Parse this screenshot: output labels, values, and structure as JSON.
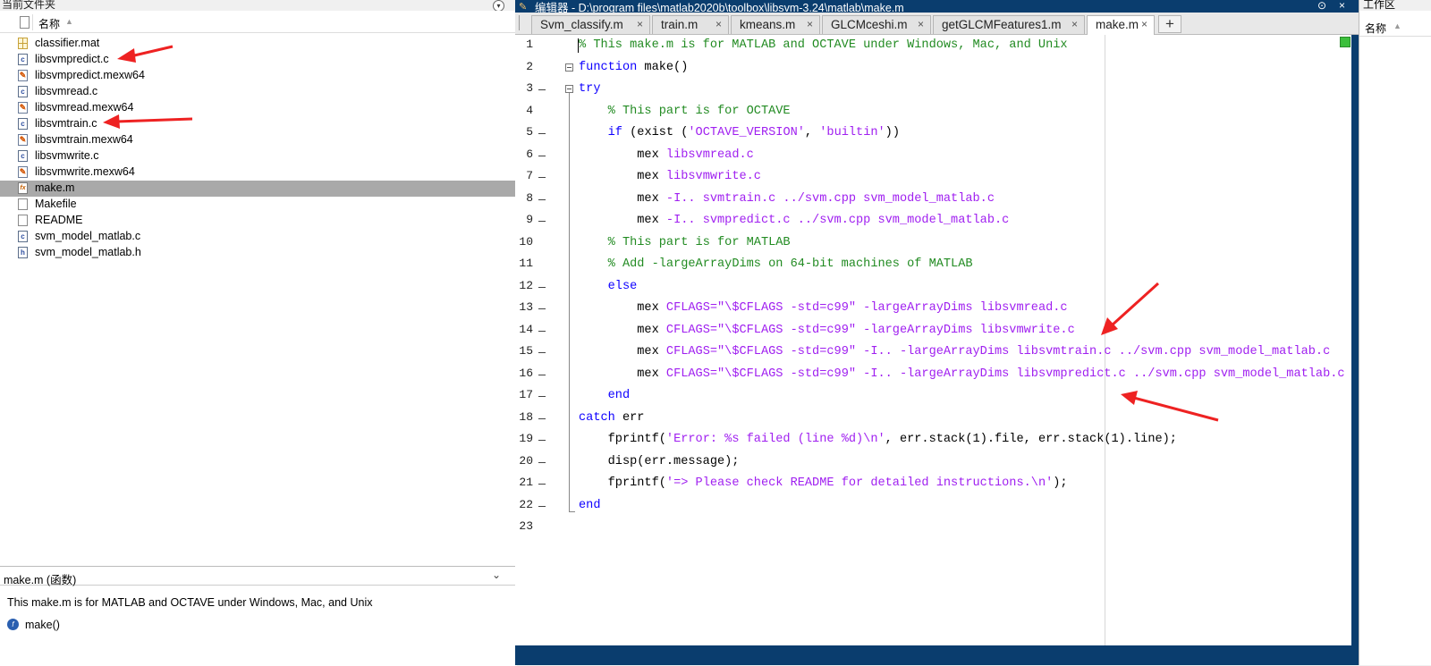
{
  "current_folder": {
    "title": "当前文件夹",
    "column_name": "名称",
    "files": [
      {
        "name": "classifier.mat",
        "type": "mat"
      },
      {
        "name": "libsvmpredict.c",
        "type": "c"
      },
      {
        "name": "libsvmpredict.mexw64",
        "type": "mex"
      },
      {
        "name": "libsvmread.c",
        "type": "c"
      },
      {
        "name": "libsvmread.mexw64",
        "type": "mex"
      },
      {
        "name": "libsvmtrain.c",
        "type": "c"
      },
      {
        "name": "libsvmtrain.mexw64",
        "type": "mex"
      },
      {
        "name": "libsvmwrite.c",
        "type": "c"
      },
      {
        "name": "libsvmwrite.mexw64",
        "type": "mex"
      },
      {
        "name": "make.m",
        "type": "m",
        "selected": true
      },
      {
        "name": "Makefile",
        "type": "plain"
      },
      {
        "name": "README",
        "type": "plain"
      },
      {
        "name": "svm_model_matlab.c",
        "type": "c"
      },
      {
        "name": "svm_model_matlab.h",
        "type": "h"
      }
    ]
  },
  "details": {
    "header": "make.m  (函数)",
    "description": "This make.m is for MATLAB and OCTAVE under Windows, Mac, and Unix",
    "function": "make()"
  },
  "editor": {
    "title": "编辑器 - D:\\program files\\matlab2020b\\toolbox\\libsvm-3.24\\matlab\\make.m",
    "tabs": [
      {
        "label": "Svm_classify.m",
        "active": false
      },
      {
        "label": "train.m",
        "active": false
      },
      {
        "label": "kmeans.m",
        "active": false
      },
      {
        "label": "GLCMceshi.m",
        "active": false
      },
      {
        "label": "getGLCMFeatures1.m",
        "active": false
      },
      {
        "label": "make.m",
        "active": true
      }
    ],
    "add_tab_label": "+",
    "close_glyph": "×",
    "lines": [
      {
        "n": "1",
        "dash": false,
        "fold": null,
        "seg": [
          [
            "cm",
            "% This make.m is for MATLAB and OCTAVE under Windows, Mac, and Unix"
          ]
        ]
      },
      {
        "n": "2",
        "dash": false,
        "fold": "box",
        "seg": [
          [
            "kw",
            "function"
          ],
          [
            "tx",
            " make()"
          ]
        ]
      },
      {
        "n": "3",
        "dash": true,
        "fold": "box",
        "seg": [
          [
            "kw",
            "try"
          ]
        ]
      },
      {
        "n": "4",
        "dash": false,
        "fold": null,
        "seg": [
          [
            "tx",
            "    "
          ],
          [
            "cm",
            "% This part is for OCTAVE"
          ]
        ]
      },
      {
        "n": "5",
        "dash": true,
        "fold": null,
        "seg": [
          [
            "tx",
            "    "
          ],
          [
            "kw",
            "if"
          ],
          [
            "tx",
            " (exist ("
          ],
          [
            "str",
            "'OCTAVE_VERSION'"
          ],
          [
            "tx",
            ", "
          ],
          [
            "str",
            "'builtin'"
          ],
          [
            "tx",
            "))"
          ]
        ]
      },
      {
        "n": "6",
        "dash": true,
        "fold": null,
        "seg": [
          [
            "tx",
            "        mex "
          ],
          [
            "str",
            "libsvmread.c"
          ]
        ]
      },
      {
        "n": "7",
        "dash": true,
        "fold": null,
        "seg": [
          [
            "tx",
            "        mex "
          ],
          [
            "str",
            "libsvmwrite.c"
          ]
        ]
      },
      {
        "n": "8",
        "dash": true,
        "fold": null,
        "seg": [
          [
            "tx",
            "        mex "
          ],
          [
            "str",
            "-I.. svmtrain.c ../svm.cpp svm_model_matlab.c"
          ]
        ]
      },
      {
        "n": "9",
        "dash": true,
        "fold": null,
        "seg": [
          [
            "tx",
            "        mex "
          ],
          [
            "str",
            "-I.. svmpredict.c ../svm.cpp svm_model_matlab.c"
          ]
        ]
      },
      {
        "n": "10",
        "dash": false,
        "fold": null,
        "seg": [
          [
            "tx",
            "    "
          ],
          [
            "cm",
            "% This part is for MATLAB"
          ]
        ]
      },
      {
        "n": "11",
        "dash": false,
        "fold": null,
        "seg": [
          [
            "tx",
            "    "
          ],
          [
            "cm",
            "% Add -largeArrayDims on 64-bit machines of MATLAB"
          ]
        ]
      },
      {
        "n": "12",
        "dash": true,
        "fold": null,
        "seg": [
          [
            "tx",
            "    "
          ],
          [
            "kw",
            "else"
          ]
        ]
      },
      {
        "n": "13",
        "dash": true,
        "fold": null,
        "seg": [
          [
            "tx",
            "        mex "
          ],
          [
            "str",
            "CFLAGS=\"\\$CFLAGS -std=c99\" -largeArrayDims libsvmread.c"
          ]
        ]
      },
      {
        "n": "14",
        "dash": true,
        "fold": null,
        "seg": [
          [
            "tx",
            "        mex "
          ],
          [
            "str",
            "CFLAGS=\"\\$CFLAGS -std=c99\" -largeArrayDims libsvmwrite.c"
          ]
        ]
      },
      {
        "n": "15",
        "dash": true,
        "fold": null,
        "seg": [
          [
            "tx",
            "        mex "
          ],
          [
            "str",
            "CFLAGS=\"\\$CFLAGS -std=c99\" -I.. -largeArrayDims libsvmtrain.c ../svm.cpp svm_model_matlab.c"
          ]
        ]
      },
      {
        "n": "16",
        "dash": true,
        "fold": null,
        "seg": [
          [
            "tx",
            "        mex "
          ],
          [
            "str",
            "CFLAGS=\"\\$CFLAGS -std=c99\" -I.. -largeArrayDims libsvmpredict.c ../svm.cpp svm_model_matlab.c"
          ]
        ]
      },
      {
        "n": "17",
        "dash": true,
        "fold": null,
        "seg": [
          [
            "tx",
            "    "
          ],
          [
            "kw",
            "end"
          ]
        ]
      },
      {
        "n": "18",
        "dash": true,
        "fold": null,
        "seg": [
          [
            "kw",
            "catch"
          ],
          [
            "tx",
            " err"
          ]
        ]
      },
      {
        "n": "19",
        "dash": true,
        "fold": null,
        "seg": [
          [
            "tx",
            "    fprintf("
          ],
          [
            "str",
            "'Error: %s failed (line %d)\\n'"
          ],
          [
            "tx",
            ", err.stack(1).file, err.stack(1).line);"
          ]
        ]
      },
      {
        "n": "20",
        "dash": true,
        "fold": null,
        "seg": [
          [
            "tx",
            "    disp(err.message);"
          ]
        ]
      },
      {
        "n": "21",
        "dash": true,
        "fold": null,
        "seg": [
          [
            "tx",
            "    fprintf("
          ],
          [
            "str",
            "'=> Please check README for detailed instructions.\\n'"
          ],
          [
            "tx",
            ");"
          ]
        ]
      },
      {
        "n": "22",
        "dash": true,
        "fold": null,
        "seg": [
          [
            "kw",
            "end"
          ]
        ]
      },
      {
        "n": "23",
        "dash": false,
        "fold": null,
        "seg": []
      }
    ]
  },
  "workspace": {
    "title": "工作区",
    "column_name": "名称"
  },
  "colors": {
    "keyword": "#0e00ff",
    "comment": "#228b22",
    "string": "#a020f0",
    "title_bar": "#0a3d6e",
    "selection": "#a9a9a9",
    "annotation_arrow": "#ee2222"
  },
  "icons": {
    "file_glyphs": {
      "mat": "",
      "c": "c",
      "mex": "✎",
      "m": "fx",
      "h": "h",
      "plain": ""
    },
    "function_glyph": "f",
    "sort_glyph": "▲",
    "chevron_glyph": "⌄",
    "collapse_glyph": "▾",
    "editor_glyph": "✎"
  }
}
